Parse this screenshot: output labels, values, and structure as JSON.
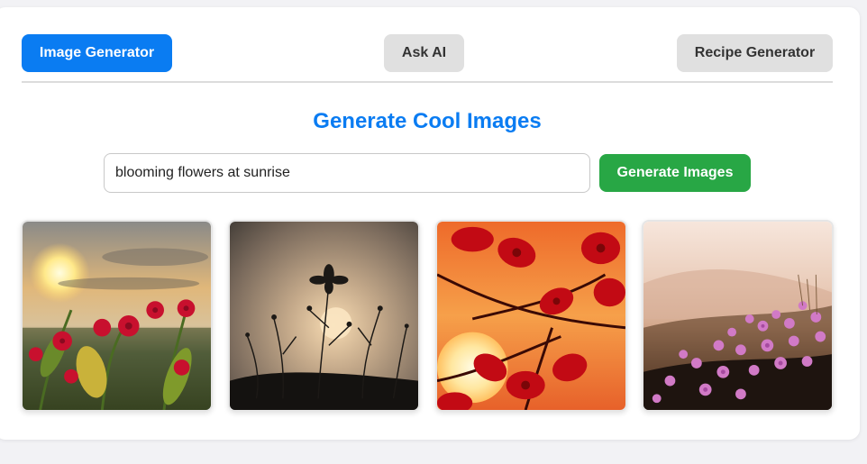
{
  "nav": {
    "image_generator": "Image Generator",
    "ask_ai": "Ask AI",
    "recipe_generator": "Recipe Generator",
    "active": "image_generator"
  },
  "main": {
    "heading": "Generate Cool Images",
    "prompt_value": "blooming flowers at sunrise",
    "generate_label": "Generate Images"
  },
  "colors": {
    "accent": "#0a7cf2",
    "generate": "#28a745",
    "inactive_tab": "#e0e0e0"
  },
  "gallery": {
    "images": [
      {
        "icon": "sunrise-meadow-red-flowers-image"
      },
      {
        "icon": "silhouette-wildflowers-sunset-image"
      },
      {
        "icon": "red-blossoms-orange-sun-image"
      },
      {
        "icon": "pink-field-flowers-hazy-image"
      }
    ]
  }
}
